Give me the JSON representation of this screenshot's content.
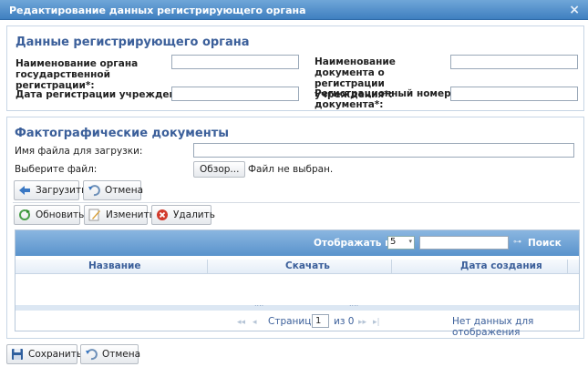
{
  "dialog": {
    "title": "Редактирование данных регистрирующего органа",
    "close_glyph": "×"
  },
  "registrar": {
    "title": "Данные регистрирующего органа",
    "org_name_label_l1": "Наименование органа",
    "org_name_label_l2": "государственной регистрации*:",
    "doc_name_label_l1": "Наименование  документа о",
    "doc_name_label_l2": "регистрации  учреждения*:",
    "reg_date_label": "Дата регистрации  учреждения*:",
    "reg_number_label_l1": "Регистрационный  номер",
    "reg_number_label_l2": "документа*:",
    "org_name_value": "",
    "doc_name_value": "",
    "reg_date_value": "",
    "reg_number_value": ""
  },
  "factual": {
    "title": "Фактографические документы",
    "filename_label": "Имя файла для загрузки:",
    "filename_value": "",
    "choose_label": "Выберите файл:",
    "browse_button": "Обзор...",
    "no_file_text": "Файл не выбран.",
    "upload_button": "Загрузить",
    "cancel_button": "Отмена",
    "refresh_button": "Обновить",
    "edit_button": "Изменить",
    "delete_button": "Удалить"
  },
  "grid": {
    "show_label": "Отображать по:",
    "page_size": "5",
    "search_value": "",
    "search_label": "Поиск",
    "columns": [
      "Название",
      "Скачать",
      "Дата создания"
    ],
    "dots": "....",
    "pager": {
      "first": "◂◂",
      "prev": "◂",
      "page_label": "Страница",
      "page_value": "1",
      "of_label": "из 0",
      "next": "▸▸",
      "last": "▸|",
      "empty_text": "Нет данных для отображения"
    }
  },
  "footer": {
    "save_button": "Сохранить",
    "cancel_button": "Отмена"
  },
  "colors": {
    "title_bar": "#4f8cc9",
    "section_title": "#3b5f9a",
    "grid_toolbar": "#6fa3d6"
  }
}
